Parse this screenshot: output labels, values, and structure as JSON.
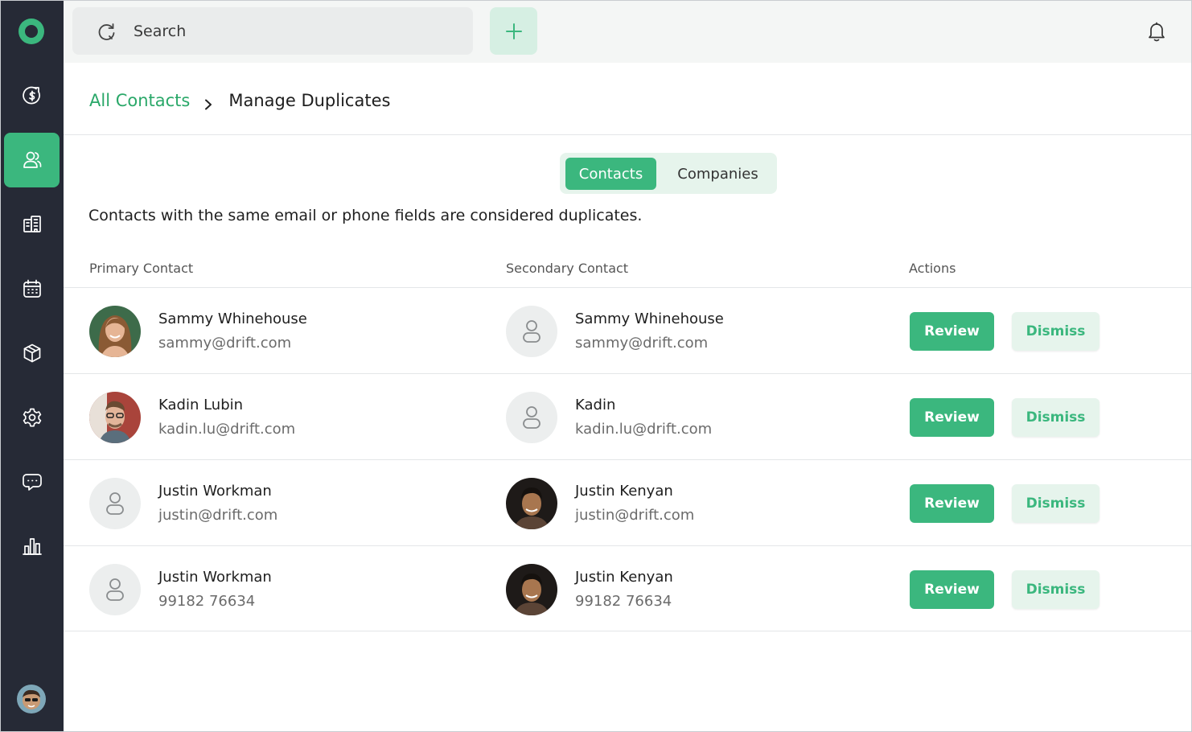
{
  "search": {
    "placeholder": "Search"
  },
  "breadcrumb": {
    "parent": "All Contacts",
    "current": "Manage Duplicates"
  },
  "tabs": [
    {
      "label": "Contacts",
      "active": true
    },
    {
      "label": "Companies",
      "active": false
    }
  ],
  "description": "Contacts with the same email or phone fields are considered duplicates.",
  "table": {
    "headers": {
      "primary": "Primary Contact",
      "secondary": "Secondary Contact",
      "actions": "Actions"
    },
    "rows": [
      {
        "primary": {
          "name": "Sammy Whinehouse",
          "detail": "sammy@drift.com",
          "avatar": "photo"
        },
        "secondary": {
          "name": "Sammy Whinehouse",
          "detail": "sammy@drift.com",
          "avatar": "placeholder"
        }
      },
      {
        "primary": {
          "name": "Kadin Lubin",
          "detail": "kadin.lu@drift.com",
          "avatar": "photo"
        },
        "secondary": {
          "name": "Kadin",
          "detail": "kadin.lu@drift.com",
          "avatar": "placeholder"
        }
      },
      {
        "primary": {
          "name": "Justin Workman",
          "detail": "justin@drift.com",
          "avatar": "placeholder"
        },
        "secondary": {
          "name": "Justin Kenyan",
          "detail": "justin@drift.com",
          "avatar": "photo"
        }
      },
      {
        "primary": {
          "name": "Justin Workman",
          "detail": "99182 76634",
          "avatar": "placeholder"
        },
        "secondary": {
          "name": "Justin Kenyan",
          "detail": "99182 76634",
          "avatar": "photo"
        }
      }
    ]
  },
  "actions": {
    "review_label": "Review",
    "dismiss_label": "Dismiss"
  },
  "sidebar": {
    "items": [
      "revenue-icon",
      "contacts-icon",
      "companies-icon",
      "calendar-icon",
      "products-icon",
      "settings-icon",
      "chat-icon",
      "reports-icon"
    ],
    "active": "contacts-icon"
  },
  "colors": {
    "accent": "#3bb77e",
    "accent_light": "#e6f4ec",
    "sidebar_bg": "#262a36"
  }
}
